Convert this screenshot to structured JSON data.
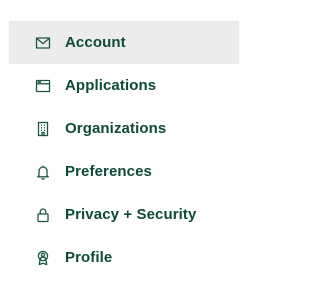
{
  "colors": {
    "accent": "#0e4a3a",
    "active_background": "#ececec"
  },
  "nav": {
    "items": [
      {
        "label": "Account",
        "icon": "envelope-icon",
        "active": true
      },
      {
        "label": "Applications",
        "icon": "browser-window-icon",
        "active": false
      },
      {
        "label": "Organizations",
        "icon": "building-icon",
        "active": false
      },
      {
        "label": "Preferences",
        "icon": "bell-icon",
        "active": false
      },
      {
        "label": "Privacy + Security",
        "icon": "lock-icon",
        "active": false
      },
      {
        "label": "Profile",
        "icon": "badge-icon",
        "active": false
      }
    ]
  }
}
